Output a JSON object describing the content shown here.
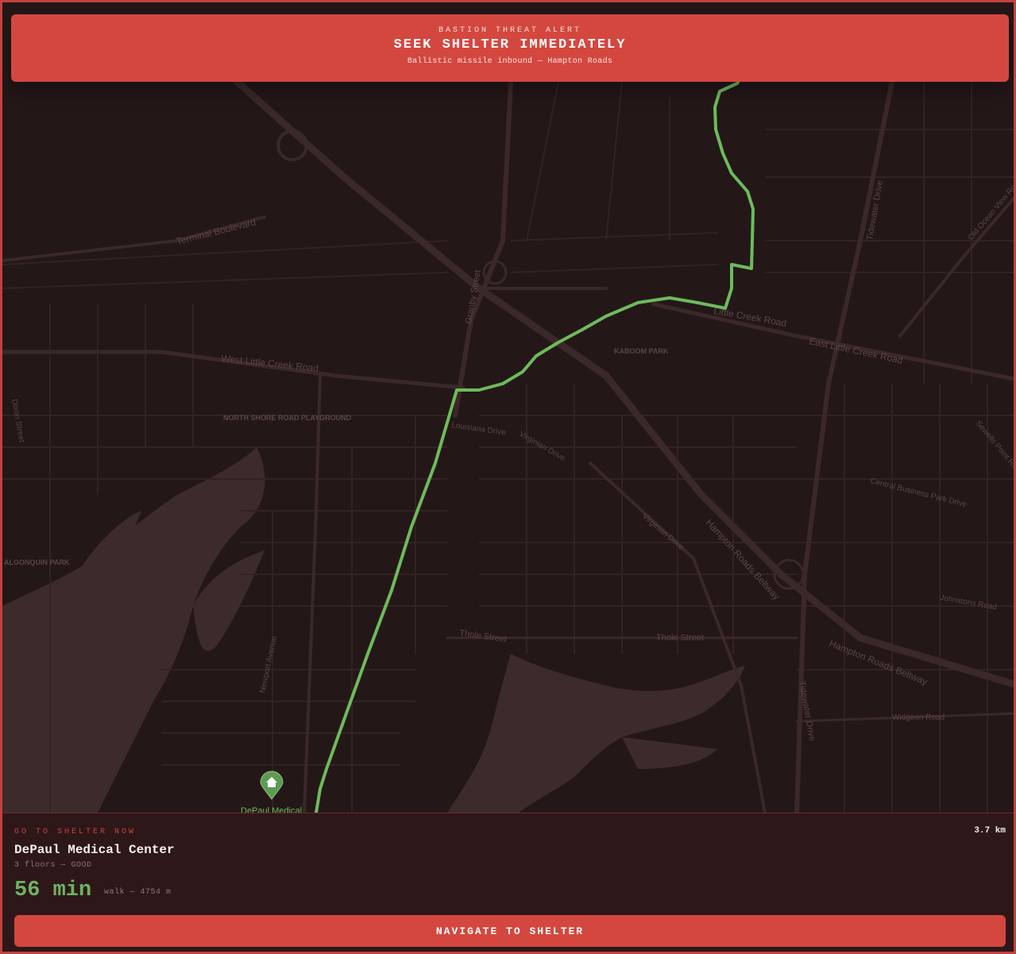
{
  "alert": {
    "kicker": "BASTION THREAT ALERT",
    "title": "SEEK SHELTER IMMEDIATELY",
    "subtitle": "Ballistic missile inbound — Hampton Roads"
  },
  "map": {
    "street_labels": [
      "Terminal Boulevard",
      "West Little Creek Road",
      "Little Creek Road",
      "East Little Creek Road",
      "Granby Street",
      "Hampton Roads Beltway",
      "Tidewater Drive",
      "Louisiana Drive",
      "Virginian Drive",
      "Thole Street",
      "Newport Avenue",
      "Central Business Park Drive",
      "Widgeon Road",
      "Johnstons Road",
      "Old Ocean View Road",
      "Sewells Point Road",
      "Dixon Street"
    ],
    "place_labels": [
      "KABOOM PARK",
      "NORTH SHORE ROAD PLAYGROUND",
      "ALGONQUIN PARK"
    ],
    "shelter_marker_label": "DePaul Medical",
    "colors": {
      "route": "#6dbb5c",
      "water": "#3d2b2c",
      "land": "#241718",
      "marker": "#5e9b52"
    }
  },
  "panel": {
    "go_label": "GO TO SHELTER NOW",
    "distance": "3.7 km",
    "shelter_name": "DePaul Medical Center",
    "meta": "3 floors — GOOD",
    "eta": "56 min",
    "walk": "walk — 4754 m",
    "button_label": "NAVIGATE TO SHELTER"
  },
  "colors": {
    "alert": "#d3473f",
    "eta": "#6fb35f",
    "panel_bg": "#2e1719"
  }
}
